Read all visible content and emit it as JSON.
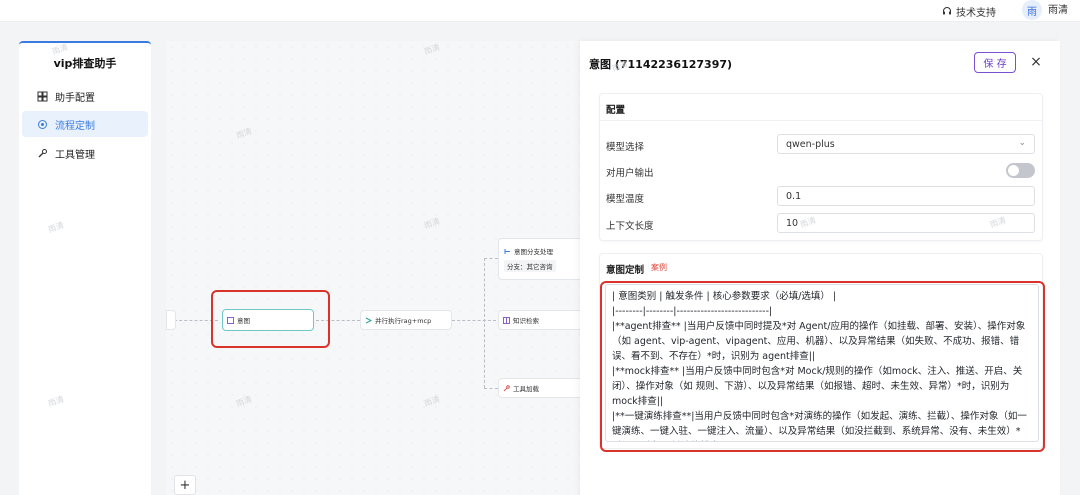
{
  "topbar": {
    "support_label": "技术支持",
    "avatar_initial": "雨",
    "username": "雨清"
  },
  "sidebar": {
    "title": "vip排查助手",
    "items": [
      {
        "label": "助手配置",
        "icon": "grid-icon",
        "active": false
      },
      {
        "label": "流程定制",
        "icon": "flow-icon",
        "active": true
      },
      {
        "label": "工具管理",
        "icon": "wrench-icon",
        "active": false
      }
    ]
  },
  "canvas": {
    "nodes": {
      "intent": "意图",
      "parallel": "并行执行rag+mcp",
      "branch": "意图分支处理",
      "branch_sub": "分支：其它咨询",
      "knowledge": "知识检索",
      "tool": "工具加载"
    },
    "add_button": "+"
  },
  "panel": {
    "title": "意图 (71142236127397)",
    "save_label": "保 存",
    "close_label": "×",
    "config": {
      "title": "配置",
      "model_label": "模型选择",
      "model_value": "qwen-plus",
      "output_label": "对用户输出",
      "temp_label": "模型温度",
      "temp_value": "0.1",
      "context_label": "上下文长度",
      "context_value": "10"
    },
    "intent_custom": {
      "title": "意图定制",
      "tag": "案例",
      "lines": [
        "| 意图类别 | 触发条件 | 核心参数要求（必填/选填） |",
        "|--------|--------|---------------------------|",
        "|**agent排查** |当用户反馈中同时提及*对 Agent/应用的操作（如挂载、部署、安装）、操作对象（如 agent、vip-agent、vipagent、应用、机器）、以及异常结果（如失败、不成功、报错、错误、看不到、不存在）*时，识别为 agent排查||",
        "|**mock排查** |当用户反馈中同时包含*对 Mock/规则的操作（如mock、注入、推送、开启、关闭）、操作对象（如 规则、下游）、以及异常结果（如报错、超时、未生效、异常）*时，识别为 mock排查||",
        "|**一键演练排查**|当用户反馈中同时包含*对演练的操作（如发起、演练、拦截）、操作对象（如一键演练、一键入驻、一键注入、流量）、以及异常结果（如没拦截到、系统异常、没有、未生效）*时，识别为 一键演练排查||"
      ]
    }
  },
  "watermark": "雨清",
  "colors": {
    "accent": "#3a7be0",
    "save": "#6b3ec7",
    "highlight": "#d9342c"
  }
}
